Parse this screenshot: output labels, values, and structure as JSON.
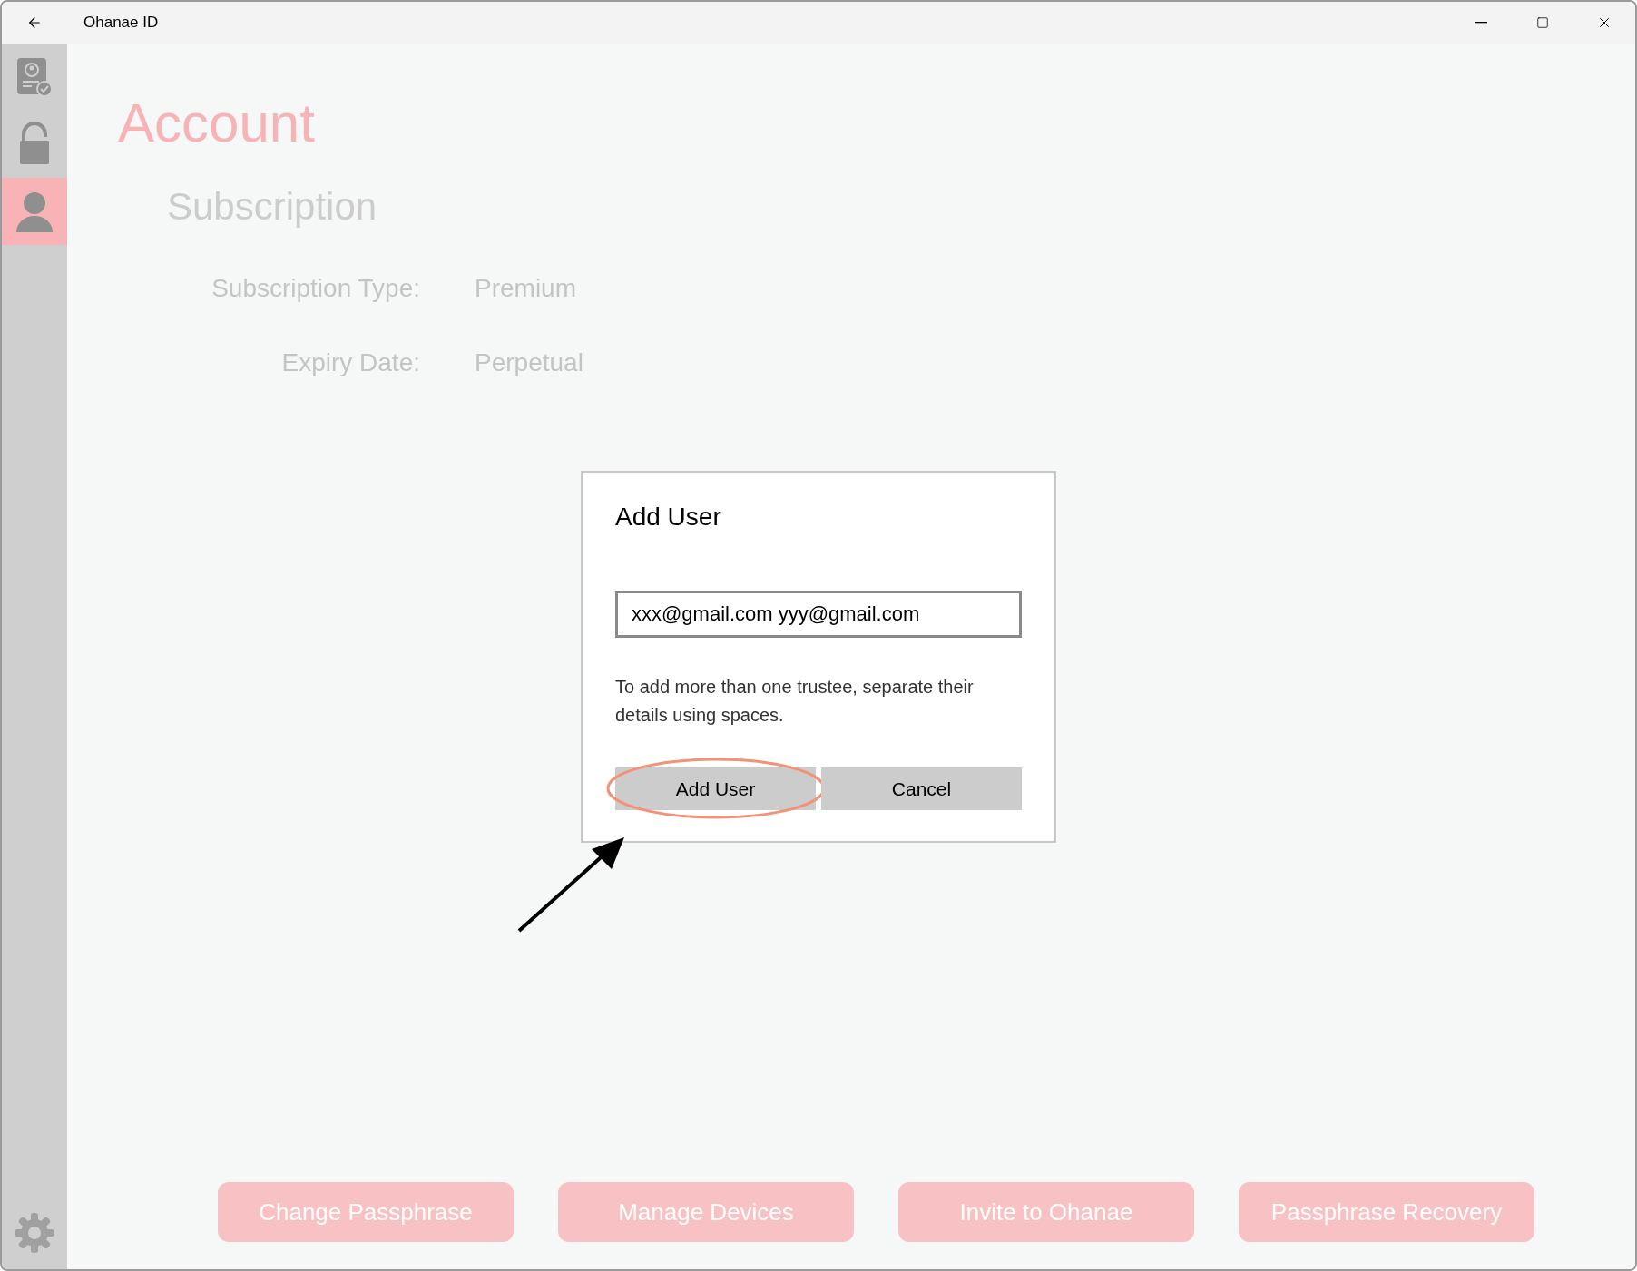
{
  "window": {
    "title": "Ohanae ID"
  },
  "sidebar": {
    "items": [
      {
        "kind": "id-card",
        "selected": false
      },
      {
        "kind": "padlock",
        "selected": false
      },
      {
        "kind": "person",
        "selected": true
      }
    ]
  },
  "page": {
    "title": "Account",
    "section": "Subscription",
    "fields": [
      {
        "label": "Subscription Type:",
        "value": "Premium"
      },
      {
        "label": "Expiry Date:",
        "value": "Perpetual"
      }
    ]
  },
  "dialog": {
    "title": "Add User",
    "input": {
      "value": "xxx@gmail.com yyy@gmail.com"
    },
    "help": "To add more than one trustee, separate their details using spaces.",
    "buttons": [
      {
        "label": "Add User",
        "highlighted": true
      },
      {
        "label": "Cancel",
        "highlighted": false
      }
    ]
  },
  "actions": [
    "Change Passphrase",
    "Manage Devices",
    "Invite to Ohanae",
    "Passphrase Recovery"
  ]
}
